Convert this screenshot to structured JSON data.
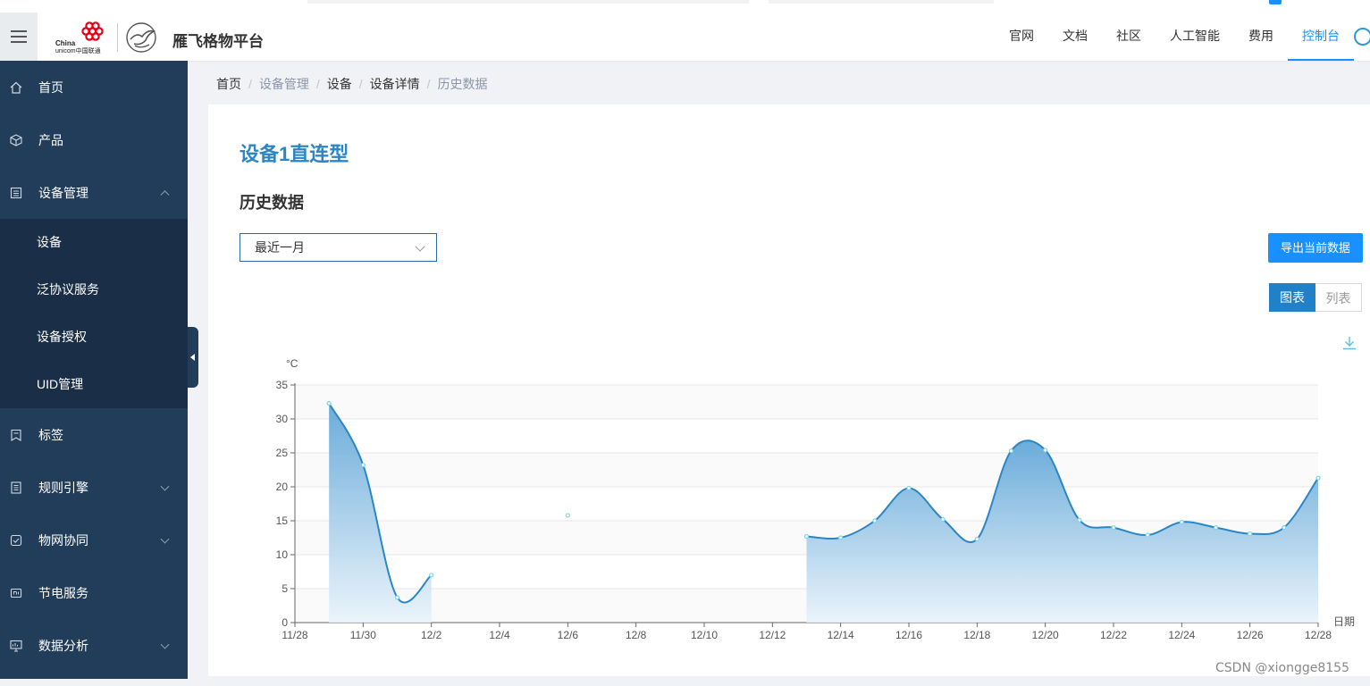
{
  "header": {
    "brand": "雁飞格物平台",
    "logo_text_1": "China",
    "logo_text_2": "unicom中国联通",
    "nav": [
      {
        "label": "官网"
      },
      {
        "label": "文档"
      },
      {
        "label": "社区"
      },
      {
        "label": "人工智能"
      },
      {
        "label": "费用"
      },
      {
        "label": "控制台",
        "active": true
      }
    ]
  },
  "sidebar": {
    "items": [
      {
        "label": "首页",
        "icon": "home-icon"
      },
      {
        "label": "产品",
        "icon": "cube-icon"
      },
      {
        "label": "设备管理",
        "icon": "list-icon",
        "expanded": true,
        "children": [
          {
            "label": "设备"
          },
          {
            "label": "泛协议服务"
          },
          {
            "label": "设备授权"
          },
          {
            "label": "UID管理"
          }
        ]
      },
      {
        "label": "标签",
        "icon": "tag-icon"
      },
      {
        "label": "规则引擎",
        "icon": "doc-icon",
        "expandable": true
      },
      {
        "label": "物网协同",
        "icon": "check-square-icon",
        "expandable": true
      },
      {
        "label": "节电服务",
        "icon": "power-icon"
      },
      {
        "label": "数据分析",
        "icon": "monitor-icon",
        "expandable": true
      }
    ]
  },
  "breadcrumb": [
    "首页",
    "设备管理",
    "设备",
    "设备详情",
    "历史数据"
  ],
  "main": {
    "device_title": "设备1直连型",
    "section_title": "历史数据",
    "range_select": "最近一月",
    "export_label": "导出当前数据",
    "view_toggle": {
      "chart": "图表",
      "list": "列表",
      "active": "chart"
    }
  },
  "chart_data": {
    "type": "area",
    "ylabel": "°C",
    "xlabel": "日期",
    "ylim": [
      0,
      35
    ],
    "yticks": [
      0,
      5,
      10,
      15,
      20,
      25,
      30,
      35
    ],
    "xticks": [
      "11/28",
      "11/30",
      "12/2",
      "12/4",
      "12/6",
      "12/8",
      "12/10",
      "12/12",
      "12/14",
      "12/16",
      "12/18",
      "12/20",
      "12/22",
      "12/24",
      "12/26",
      "12/28"
    ],
    "x": [
      "11/28",
      "11/29",
      "11/30",
      "12/1",
      "12/2",
      "12/3",
      "12/4",
      "12/5",
      "12/6",
      "12/7",
      "12/8",
      "12/9",
      "12/10",
      "12/11",
      "12/12",
      "12/13",
      "12/14",
      "12/15",
      "12/16",
      "12/17",
      "12/18",
      "12/19",
      "12/20",
      "12/21",
      "12/22",
      "12/23",
      "12/24",
      "12/25",
      "12/26",
      "12/27",
      "12/28"
    ],
    "series": [
      {
        "values": [
          null,
          32.3,
          23.2,
          3.7,
          7.0,
          null,
          null,
          null,
          15.8,
          null,
          null,
          null,
          null,
          null,
          null,
          12.7,
          12.5,
          15.0,
          19.8,
          15.2,
          12.3,
          25.3,
          25.4,
          15.1,
          14.0,
          12.9,
          14.8,
          14.0,
          13.1,
          14.0,
          21.3
        ],
        "color": "#2b86c5"
      }
    ],
    "grid": true,
    "colors": {
      "line": "#2b86c5",
      "area_top": "#5aa3d6",
      "area_bottom": "#e9f3fb",
      "point": "#7fd3e6"
    }
  },
  "watermark": "CSDN @xiongge8155"
}
